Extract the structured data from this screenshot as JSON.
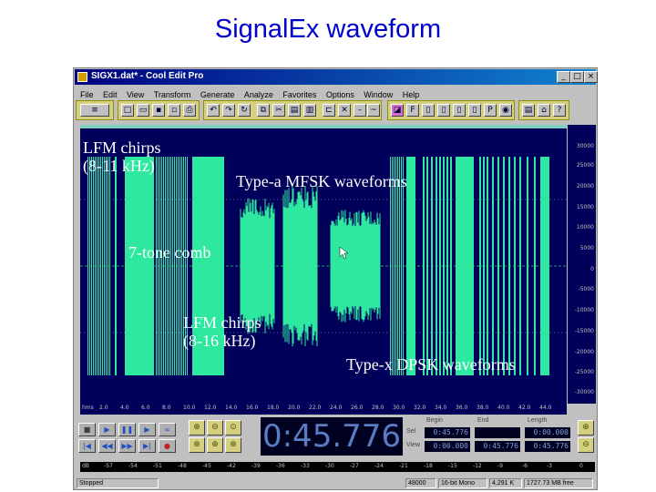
{
  "slide_title": "SignalEx waveform",
  "window": {
    "title": "SIGX1.dat* - Cool Edit Pro",
    "buttons": [
      "_",
      "□",
      "×"
    ]
  },
  "menu": [
    "File",
    "Edit",
    "View",
    "Transform",
    "Generate",
    "Analyze",
    "Favorites",
    "Options",
    "Window",
    "Help"
  ],
  "amplitude_scale": [
    "30000",
    "25000",
    "20000",
    "15000",
    "10000",
    "5000",
    "0",
    "-5000",
    "-10000",
    "-15000",
    "-20000",
    "-25000",
    "-30000"
  ],
  "timeline_labels": [
    "hms",
    "2.0",
    "4.0",
    "6.0",
    "8.0",
    "10.0",
    "12.0",
    "14.0",
    "16.0",
    "18.0",
    "20.0",
    "22.0",
    "24.0",
    "26.0",
    "28.0",
    "30.0",
    "32.0",
    "34.0",
    "36.0",
    "38.0",
    "40.0",
    "42.0",
    "44.0"
  ],
  "time_display": "0:45.776",
  "selection": {
    "headers": [
      "Begin",
      "End",
      "Length"
    ],
    "rows": [
      {
        "label": "Sel",
        "values": [
          "0:45.776",
          "",
          "0:00.000"
        ]
      },
      {
        "label": "View",
        "values": [
          "0:00.000",
          "0:45.776",
          "0:45.776"
        ]
      }
    ]
  },
  "level_labels": [
    "dB",
    "-57",
    "-54",
    "-51",
    "-48",
    "-45",
    "-42",
    "-39",
    "-36",
    "-33",
    "-30",
    "-27",
    "-24",
    "-21",
    "-18",
    "-15",
    "-12",
    "-9",
    "-6",
    "-3",
    "0"
  ],
  "status": {
    "state": "Stopped",
    "sample_rate": "48000",
    "format": "16-bit Mono",
    "size": "4,291 K",
    "free": "1727.73 MB free"
  },
  "annotations": {
    "lfm1": [
      "LFM chirps",
      "(8-11 kHz)"
    ],
    "mfsk": "Type-a MFSK waveforms",
    "comb": "7-tone comb",
    "lfm2": [
      "LFM chirps",
      "(8-16 kHz)"
    ],
    "dpsk": "Type-x DPSK waveforms"
  },
  "colors": {
    "wave_bg": "#00005a",
    "waveform": "#2ee8a0",
    "title": "#0000cc",
    "annotation": "#ffffff"
  },
  "icons": {
    "transport": [
      "stop-icon",
      "play-icon",
      "pause-icon",
      "play-looped-icon",
      "loop-icon",
      "goto-start-icon",
      "rewind-icon",
      "fast-forward-icon",
      "goto-end-icon",
      "record-icon"
    ],
    "toolbar": [
      "multitrack-icon",
      "new-icon",
      "open-icon",
      "save-icon",
      "close-icon",
      "print-icon",
      "undo-icon",
      "redo-icon",
      "repeat-icon",
      "copy-icon",
      "cut-icon",
      "paste-icon",
      "mix-paste-icon",
      "trim-icon",
      "delete-icon",
      "fx-icon",
      "help-icon"
    ]
  }
}
